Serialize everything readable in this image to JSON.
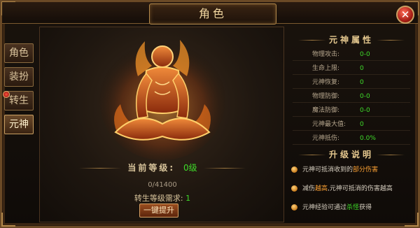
{
  "window": {
    "title": "角色"
  },
  "icons": {
    "close": "close-x-icon",
    "tab_alert": "red-dot-icon",
    "bullet": "orange-orb-icon"
  },
  "colors": {
    "accent_gold": "#c9a063",
    "value_green": "#3fdc2a",
    "highlight_orange": "#ffa334",
    "close_red": "#a31b13"
  },
  "tabs": [
    {
      "label": "角色"
    },
    {
      "label": "装扮"
    },
    {
      "label": "转生",
      "has_alert": true
    },
    {
      "label": "元神",
      "active": true
    }
  ],
  "main": {
    "level_label": "当前等级:",
    "level_value": "0级",
    "exp_text": "0/41400",
    "requirement_label": "转生等级需求:",
    "requirement_value": "1",
    "upgrade_button": "一键提升"
  },
  "attributes": {
    "title": "元神属性",
    "rows": [
      {
        "label": "物理攻击:",
        "value": "0-0"
      },
      {
        "label": "生命上限:",
        "value": "0"
      },
      {
        "label": "元神恢复:",
        "value": "0"
      },
      {
        "label": "物理防御:",
        "value": "0-0"
      },
      {
        "label": "魔法防御:",
        "value": "0-0"
      },
      {
        "label": "元神最大值:",
        "value": "0"
      },
      {
        "label": "元神抵伤:",
        "value": "0.0%"
      }
    ]
  },
  "upgrade_info": {
    "title": "升级说明",
    "items": [
      {
        "pre": "元神可抵消收到的",
        "hl": "部分伤害",
        "post": "",
        "hl_color": "orange"
      },
      {
        "pre": "减伤",
        "hl": "越高",
        "post": ",元神可抵消的伤害越高",
        "hl_color": "orange"
      },
      {
        "pre": "元神经验可通过",
        "hl": "杀怪",
        "post": "获得",
        "hl_color": "green"
      }
    ]
  }
}
